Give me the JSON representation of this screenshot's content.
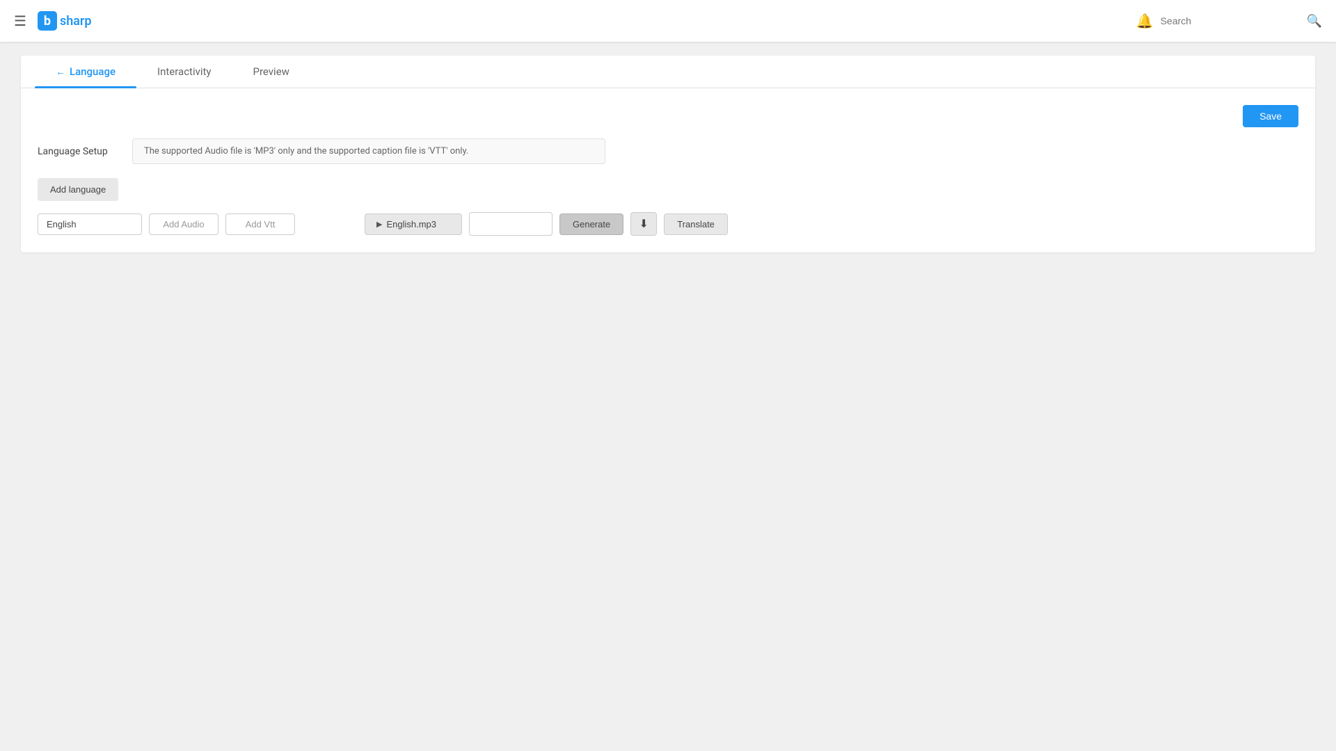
{
  "nav": {
    "hamburger_icon": "☰",
    "logo_b": "b",
    "logo_text": "sharp",
    "bell_icon": "🔔",
    "search_placeholder": "Search",
    "search_icon": "🔍"
  },
  "tabs": {
    "items": [
      {
        "id": "language",
        "label": "Language",
        "active": true,
        "has_back": true
      },
      {
        "id": "interactivity",
        "label": "Interactivity",
        "active": false,
        "has_back": false
      },
      {
        "id": "preview",
        "label": "Preview",
        "active": false,
        "has_back": false
      }
    ]
  },
  "toolbar": {
    "save_label": "Save"
  },
  "language_section": {
    "setup_label": "Language Setup",
    "info_text": "The supported Audio file is 'MP3' only and the supported caption file is 'VTT' only.",
    "add_language_label": "Add language",
    "language_row": {
      "language_value": "English",
      "add_audio_placeholder": "Add Audio",
      "add_vtt_placeholder": "Add Vtt",
      "audio_player_label": "English.mp3",
      "generate_label": "Generate",
      "download_icon": "⬇",
      "translate_label": "Translate"
    }
  }
}
